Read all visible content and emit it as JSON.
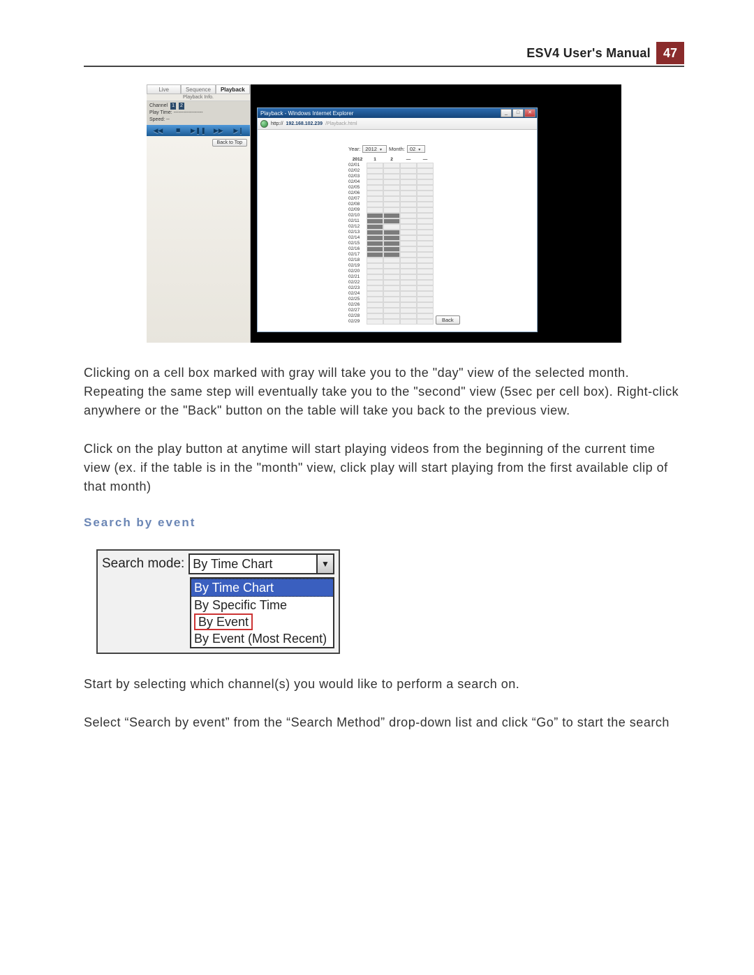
{
  "header": {
    "title": "ESV4 User's Manual",
    "page": "47"
  },
  "panel": {
    "tabs": {
      "live": "Live",
      "sequence": "Sequence",
      "playback": "Playback"
    },
    "pbinfo_label": "Playback Info.",
    "channel_label": "Channel",
    "channel_values": [
      "1",
      "2"
    ],
    "playtime_label": "Play Time:",
    "playtime_value": "------------------",
    "speed_label": "Speed:",
    "speed_value": "--",
    "back_to_top": "Back to Top",
    "popup": {
      "title": "Playback - Windows Internet Explorer",
      "url_host": "192.168.102.239",
      "url_path": "/Playback.html",
      "year_label": "Year:",
      "month_label": "Month:",
      "back_btn": "Back"
    }
  },
  "chart_data": {
    "type": "heatmap",
    "title": "",
    "xlabel": "",
    "ylabel": "",
    "year": "2012",
    "month": "02",
    "columns": [
      "2012",
      "1",
      "2",
      "—",
      "—"
    ],
    "rows": [
      "02/01",
      "02/02",
      "02/03",
      "02/04",
      "02/05",
      "02/06",
      "02/07",
      "02/08",
      "02/09",
      "02/10",
      "02/11",
      "02/12",
      "02/13",
      "02/14",
      "02/15",
      "02/16",
      "02/17",
      "02/18",
      "02/19",
      "02/20",
      "02/21",
      "02/22",
      "02/23",
      "02/24",
      "02/25",
      "02/26",
      "02/27",
      "02/28",
      "02/29"
    ],
    "filled_rows": [
      "02/10",
      "02/11",
      "02/12",
      "02/13",
      "02/14",
      "02/15",
      "02/16",
      "02/17"
    ],
    "filled_cols_per_row": {
      "02/10": [
        0,
        1
      ],
      "02/11": [
        0,
        1
      ],
      "02/12": [
        0
      ],
      "02/13": [
        0,
        1
      ],
      "02/14": [
        0,
        1
      ],
      "02/15": [
        0,
        1
      ],
      "02/16": [
        0,
        1
      ],
      "02/17": [
        0,
        1
      ]
    }
  },
  "body": {
    "p1": "Clicking on a cell box marked with gray will take you to the \"day\" view of the selected month. Repeating the same step will eventually take you to the \"second\" view (5sec per cell box). Right-click anywhere or the \"Back\" button on the table will take you back to the previous view.",
    "p2": "Click on the play button at anytime will start playing videos from the beginning of the current time view (ex. if the table is in the \"month\" view, click play will start playing from the first available clip of that month)",
    "h_search": "Search by event",
    "p3": "Start by selecting which channel(s) you would like to perform a search on.",
    "p4": "Select “Search by event” from the “Search Method” drop-down list and click “Go” to start the search"
  },
  "search_shot": {
    "label": "Search mode:",
    "selected": "By Time Chart",
    "options": [
      "By Time Chart",
      "By Specific Time",
      "By Event",
      "By Event (Most Recent)"
    ]
  }
}
